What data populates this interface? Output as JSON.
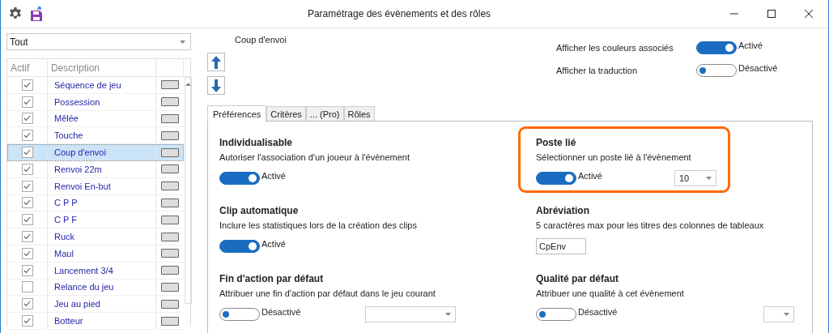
{
  "window": {
    "title": "Paramétrage des évènements et des rôles"
  },
  "filter": {
    "value": "Tout"
  },
  "table": {
    "columns": [
      "Actif",
      "Description"
    ],
    "rows": [
      {
        "checked": true,
        "description": "Séquence de jeu",
        "selected": false
      },
      {
        "checked": true,
        "description": "Possession",
        "selected": false
      },
      {
        "checked": true,
        "description": "Mêlée",
        "selected": false
      },
      {
        "checked": true,
        "description": "Touche",
        "selected": false
      },
      {
        "checked": true,
        "description": "Coup d'envoi",
        "selected": true
      },
      {
        "checked": true,
        "description": "Renvoi 22m",
        "selected": false
      },
      {
        "checked": true,
        "description": "Renvoi En-but",
        "selected": false
      },
      {
        "checked": true,
        "description": "C P P",
        "selected": false
      },
      {
        "checked": true,
        "description": "C P F",
        "selected": false
      },
      {
        "checked": true,
        "description": "Ruck",
        "selected": false
      },
      {
        "checked": true,
        "description": "Maul",
        "selected": false
      },
      {
        "checked": true,
        "description": "Lancement 3/4",
        "selected": false
      },
      {
        "checked": false,
        "description": "Relance du jeu",
        "selected": false
      },
      {
        "checked": true,
        "description": "Jeu au pied",
        "selected": false
      },
      {
        "checked": true,
        "description": "Botteur",
        "selected": false
      }
    ]
  },
  "selected_event": "Coup d'envoi",
  "display_options": [
    {
      "label": "Afficher les couleurs associés",
      "on": true,
      "state_label": "Activé"
    },
    {
      "label": "Afficher la traduction",
      "on": false,
      "state_label": "Désactivé"
    }
  ],
  "tabs": [
    {
      "label": "Préférences",
      "selected": true
    },
    {
      "label": "Critères",
      "selected": false
    },
    {
      "label": "... (Pro)",
      "selected": false
    },
    {
      "label": "Rôles",
      "selected": false
    }
  ],
  "settings": [
    {
      "kind": "toggle",
      "title": "Individualisable",
      "description": "Autoriser l'association d'un joueur à l'évènement",
      "on": true,
      "state_label": "Activé",
      "highlighted": false
    },
    {
      "kind": "toggle-select",
      "title": "Poste lié",
      "description": "Sélectionner un poste lié à l'évènement",
      "on": true,
      "state_label": "Activé",
      "value": "10",
      "highlighted": true
    },
    {
      "kind": "toggle",
      "title": "Clip automatique",
      "description": "Inclure les statistiques lors de la création des clips",
      "on": true,
      "state_label": "Activé",
      "highlighted": false
    },
    {
      "kind": "text",
      "title": "Abréviation",
      "description": "5 caractères max pour les titres des colonnes de tableaux",
      "value": "CpEnv",
      "highlighted": false
    },
    {
      "kind": "toggle-select",
      "title": "Fin d'action par défaut",
      "description": "Attribuer une fin d'action par défaut dans le jeu courant",
      "on": false,
      "state_label": "Désactivé",
      "highlighted": false
    },
    {
      "kind": "toggle-select",
      "title": "Qualité par défaut",
      "description": "Attribuer une qualité à cet évènement",
      "on": false,
      "state_label": "Désactivé",
      "highlighted": false
    }
  ]
}
